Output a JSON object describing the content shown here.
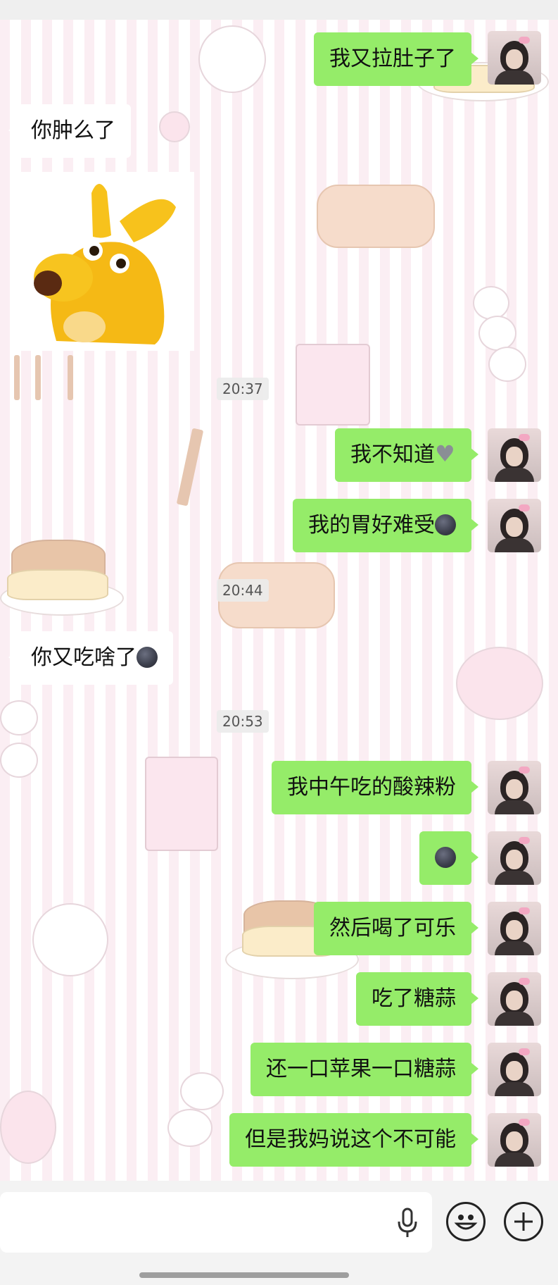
{
  "timestamps": [
    "20:37",
    "20:44",
    "20:53"
  ],
  "messages": [
    {
      "side": "out",
      "text": "我又拉肚子了"
    },
    {
      "side": "in",
      "text": "你肿么了"
    },
    {
      "side": "in",
      "type": "sticker",
      "icon": "yellow-dog-sticker"
    },
    {
      "side": "out",
      "text": "我不知道",
      "emoji": "broken-heart-emoji"
    },
    {
      "side": "out",
      "text": "我的胃好难受",
      "emoji": "new-moon-face-emoji"
    },
    {
      "side": "in",
      "text": "你又吃啥了",
      "emoji": "new-moon-face-emoji"
    },
    {
      "side": "out",
      "text": "我中午吃的酸辣粉"
    },
    {
      "side": "out",
      "text": "",
      "emoji": "new-moon-face-emoji"
    },
    {
      "side": "out",
      "text": "然后喝了可乐"
    },
    {
      "side": "out",
      "text": "吃了糖蒜"
    },
    {
      "side": "out",
      "text": "还一口苹果一口糖蒜"
    },
    {
      "side": "out",
      "text": "但是我妈说这个不可能"
    }
  ],
  "colors": {
    "outgoing_bubble": "#95ec69",
    "incoming_bubble": "#ffffff"
  },
  "input_bar": {
    "icons": [
      "microphone-icon",
      "emoji-icon",
      "plus-icon"
    ]
  }
}
